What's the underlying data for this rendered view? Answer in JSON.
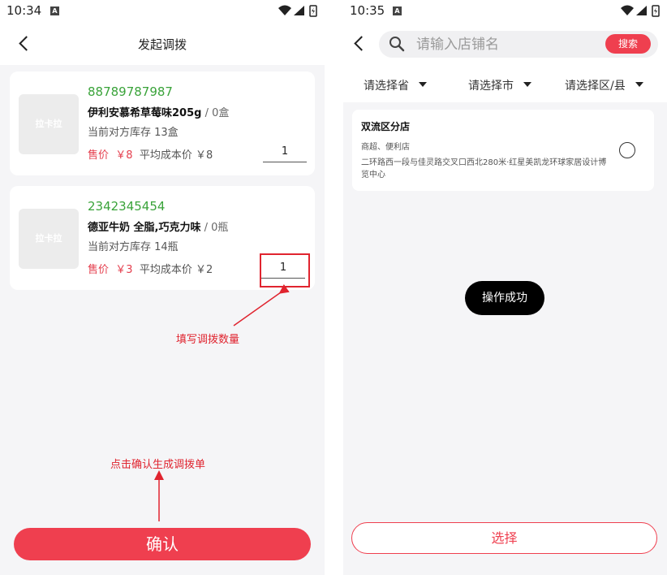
{
  "left": {
    "status_time": "10:34",
    "title": "发起调拨",
    "products": [
      {
        "code": "88789787987",
        "name": "伊利安慕希草莓味205g",
        "unit_text": " / 0盒",
        "stock": "当前对方库存 13盒",
        "sale_label": "售价",
        "sale_price": "￥8",
        "cost_text": "平均成本价 ￥8",
        "quantity": "1",
        "thumb_text": "拉卡拉"
      },
      {
        "code": "2342345454",
        "name": "德亚牛奶 全脂,巧克力味",
        "unit_text": " / 0瓶",
        "stock": "当前对方库存 14瓶",
        "sale_label": "售价",
        "sale_price": "￥3",
        "cost_text": "平均成本价 ￥2",
        "quantity": "1",
        "thumb_text": "拉卡拉"
      }
    ],
    "annotation_qty": "填写调拨数量",
    "annotation_confirm": "点击确认生成调拨单",
    "confirm_label": "确认"
  },
  "right": {
    "status_time": "10:35",
    "search": {
      "placeholder": "请输入店铺名",
      "button": "搜索"
    },
    "filters": [
      "请选择省",
      "请选择市",
      "请选择区/县"
    ],
    "store": {
      "name": "双流区分店",
      "type": "商超、便利店",
      "address": "二环路西一段与佳灵路交叉口西北280米·红星美凯龙环球家居设计博览中心"
    },
    "toast": "操作成功",
    "select_label": "选择"
  },
  "colors": {
    "accent": "#ef3f4f",
    "code_green": "#3aa33a",
    "annotation_red": "#e0242f"
  },
  "icons": [
    "back-arrow-icon",
    "search-icon",
    "wifi-icon",
    "signal-icon",
    "battery-icon",
    "android-a-icon"
  ]
}
